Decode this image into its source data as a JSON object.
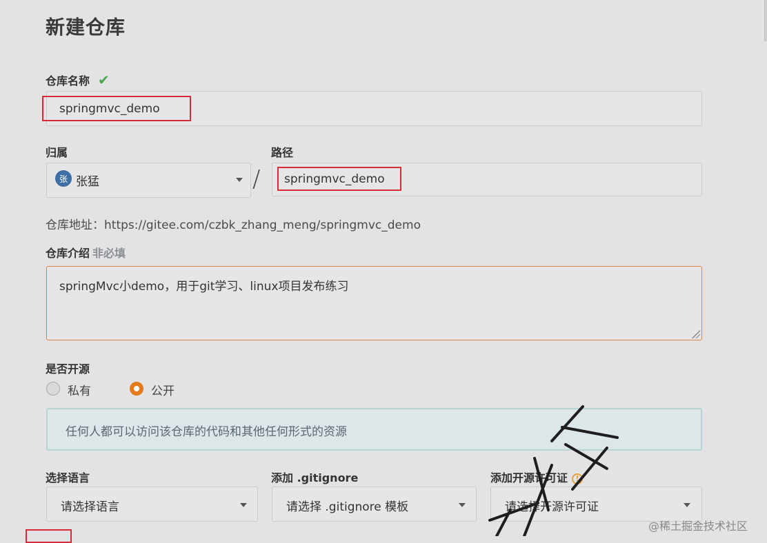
{
  "page": {
    "title": "新建仓库"
  },
  "repo_name": {
    "label": "仓库名称",
    "value": "springmvc_demo"
  },
  "owner": {
    "label": "归属",
    "avatar_char": "张",
    "value": "张猛"
  },
  "path": {
    "label": "路径",
    "separator": "/",
    "value": "springmvc_demo"
  },
  "repo_url": {
    "text": "仓库地址：https://gitee.com/czbk_zhang_meng/springmvc_demo"
  },
  "description": {
    "label": "仓库介绍",
    "optional": "非必填",
    "value": "springMvc小demo，用于git学习、linux项目发布练习"
  },
  "visibility": {
    "label": "是否开源",
    "options": [
      {
        "label": "私有",
        "selected": false
      },
      {
        "label": "公开",
        "selected": true
      }
    ],
    "info": "任何人都可以访问该仓库的代码和其他任何形式的资源"
  },
  "language": {
    "label": "选择语言",
    "placeholder": "请选择语言"
  },
  "gitignore": {
    "label": "添加 .gitignore",
    "placeholder": "请选择 .gitignore 模板"
  },
  "license": {
    "label": "添加开源许可证",
    "placeholder": "请选择开源许可证"
  },
  "watermark": "@稀土掘金技术社区",
  "colors": {
    "accent": "#e37b1c",
    "highlight": "#d52b35",
    "check": "#4aa84f"
  }
}
